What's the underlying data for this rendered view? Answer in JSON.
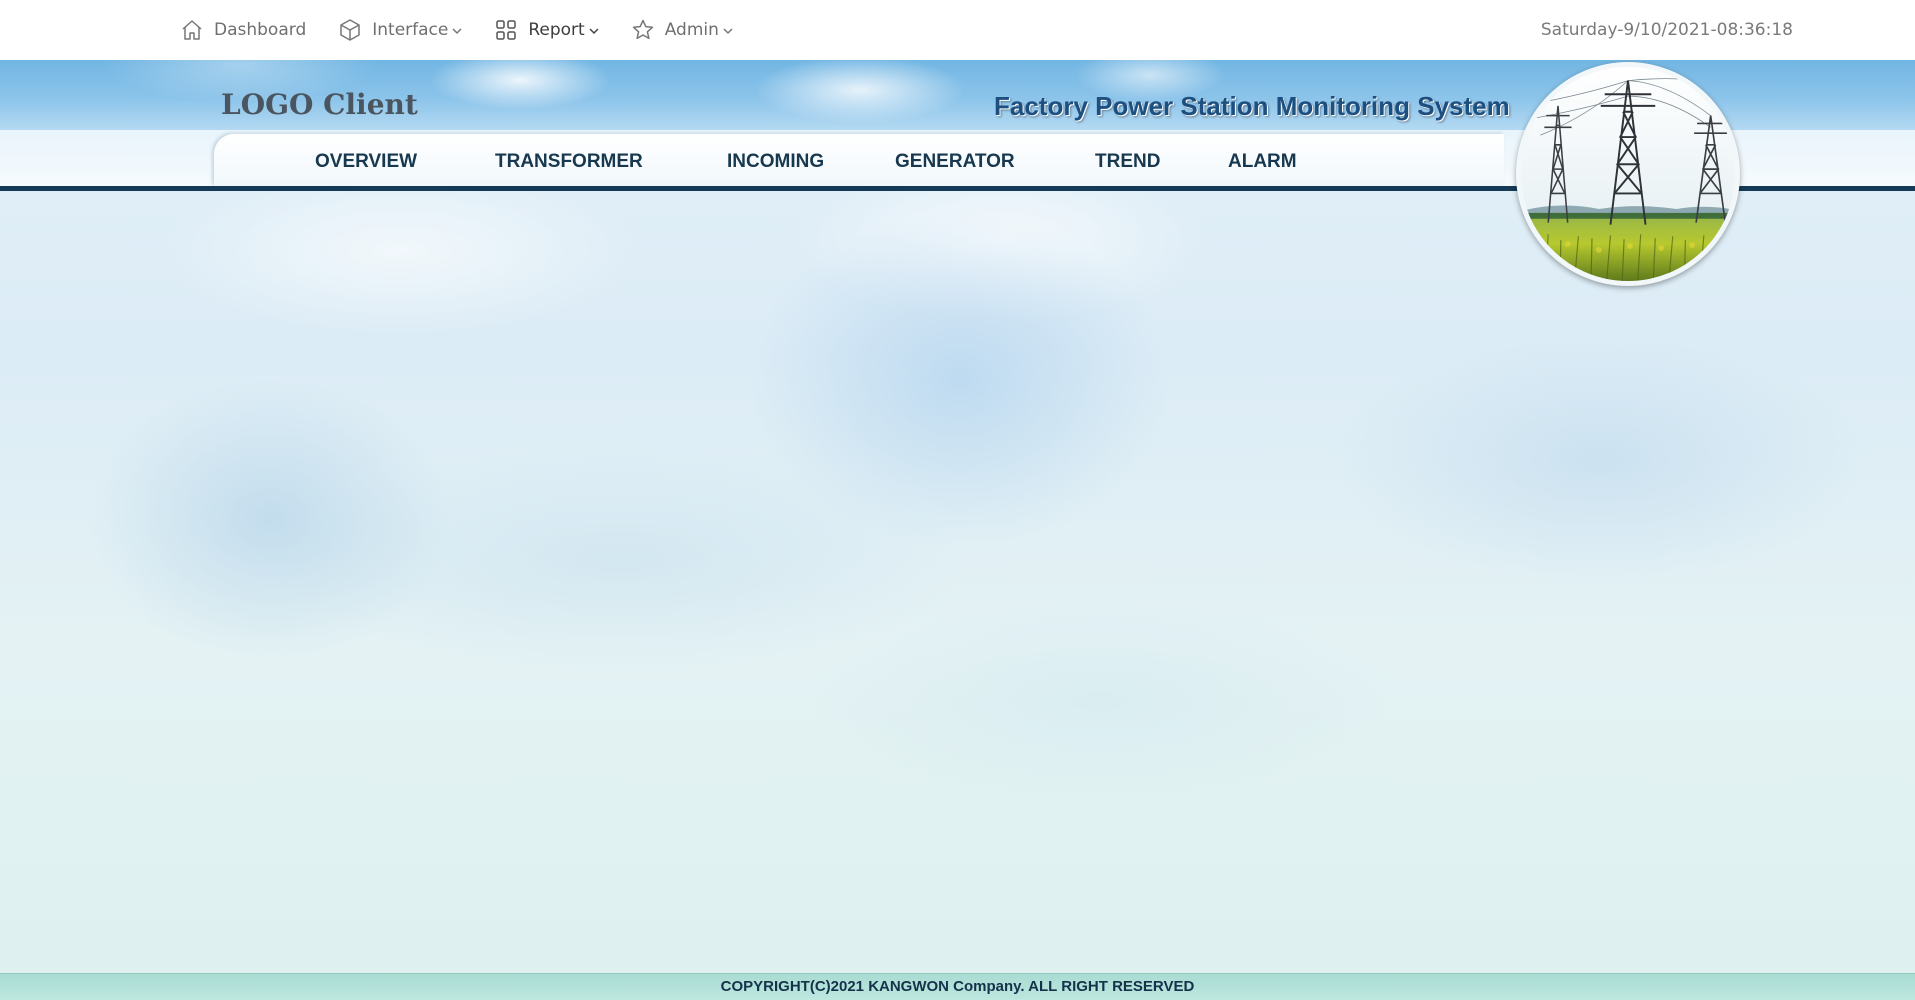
{
  "topnav": {
    "items": [
      {
        "label": "Dashboard",
        "icon": "home-icon",
        "has_dropdown": false
      },
      {
        "label": "Interface",
        "icon": "cube-icon",
        "has_dropdown": true
      },
      {
        "label": "Report",
        "icon": "grid-icon",
        "has_dropdown": true,
        "active": true
      },
      {
        "label": "Admin",
        "icon": "star-icon",
        "has_dropdown": true
      }
    ],
    "datetime": "Saturday-9/10/2021-08:36:18"
  },
  "header": {
    "logo": "LOGO Client",
    "title": "Factory Power Station Monitoring System",
    "image": "power-tower-field-image"
  },
  "menu": {
    "items": [
      "OVERVIEW",
      "TRANSFORMER",
      "INCOMING",
      "GENERATOR",
      "TREND",
      "ALARM"
    ]
  },
  "footer": {
    "copyright": "COPYRIGHT(C)2021 KANGWON Company. ALL RIGHT RESERVED"
  },
  "colors": {
    "menu_text": "#17384f",
    "menu_line": "#143a57",
    "title": "#1d4f80",
    "footer_bg": "#b3e1d8"
  }
}
